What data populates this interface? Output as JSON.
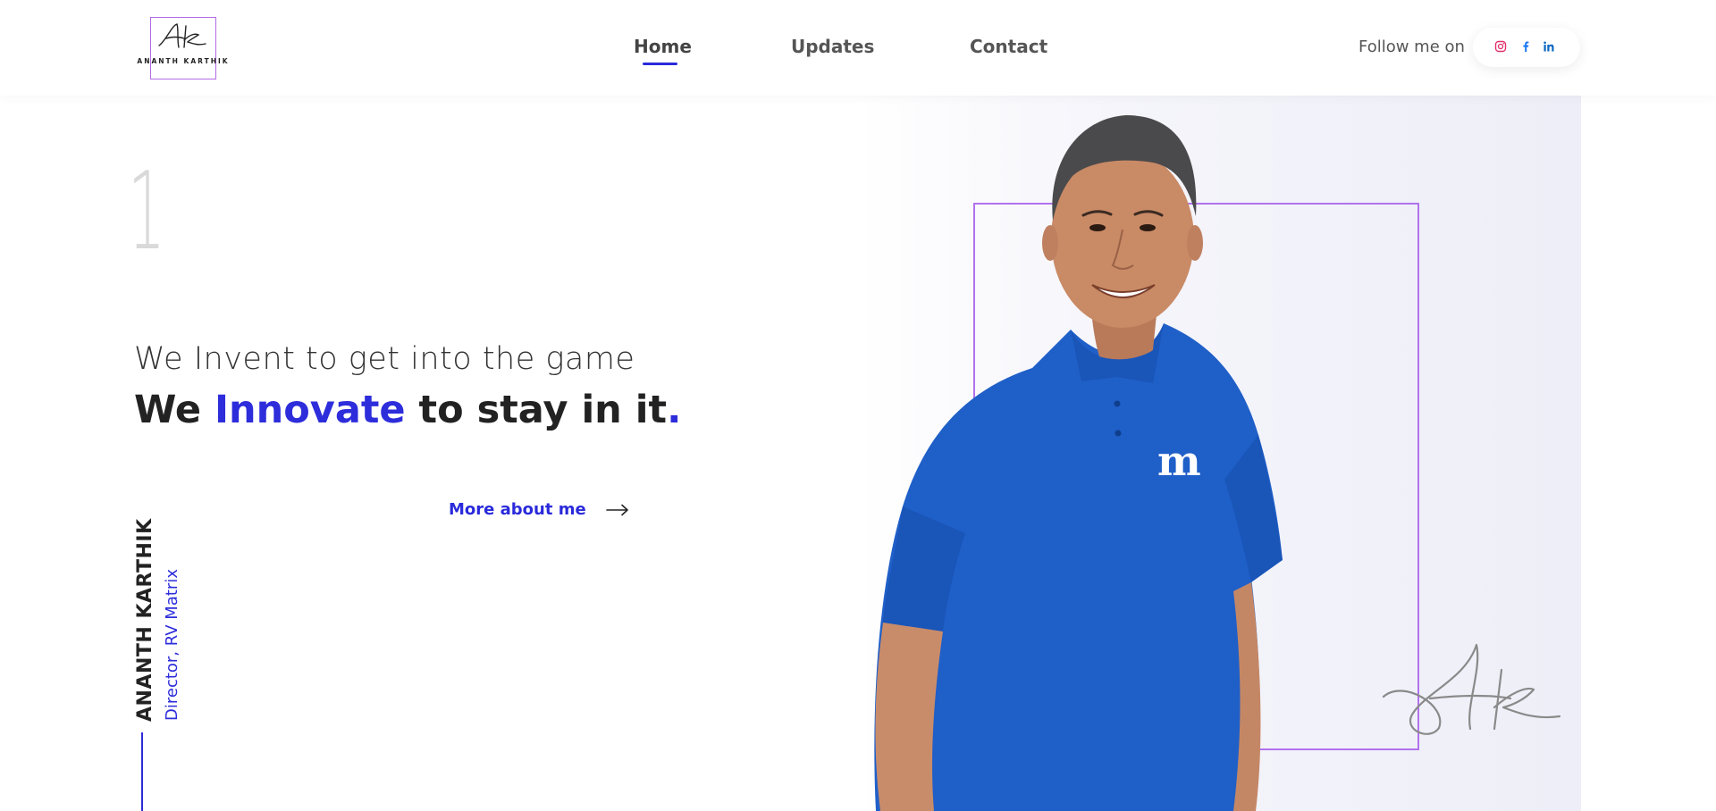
{
  "header": {
    "logo": {
      "monogram": "Ak",
      "name": "ANANTH KARTHIK"
    },
    "nav": [
      {
        "label": "Home",
        "active": true
      },
      {
        "label": "Updates",
        "active": false
      },
      {
        "label": "Contact",
        "active": false
      }
    ],
    "follow_label": "Follow me on",
    "social": [
      {
        "icon": "instagram-icon"
      },
      {
        "icon": "facebook-icon"
      },
      {
        "icon": "linkedin-icon"
      }
    ]
  },
  "hero": {
    "slide_number": "1",
    "tagline_line1": "We Invent to get into the game",
    "tagline_line2": {
      "part1": "We ",
      "accent": "Innovate",
      "part2": " to stay in it",
      "dot": "."
    },
    "cta_label": "More about me",
    "name": "ANANTH KARTHIK",
    "role": "Director, RV Matrix",
    "signature": "Ak"
  },
  "colors": {
    "accent": "#2d2ddb",
    "frame": "#b172ec",
    "shirt": "#1f5fc8"
  }
}
